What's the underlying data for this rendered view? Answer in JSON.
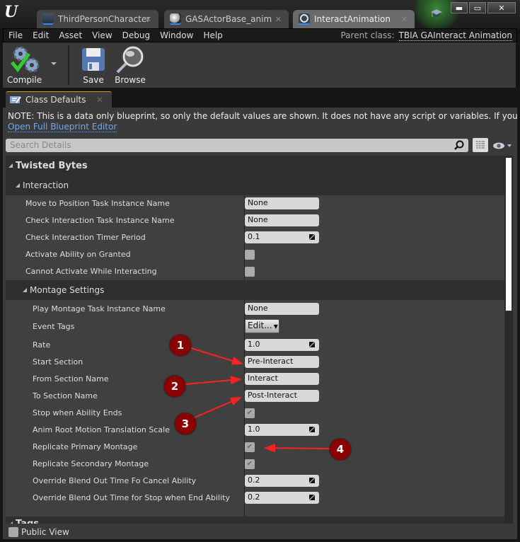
{
  "window": {
    "tabs": [
      {
        "label": "ThirdPersonCharacter",
        "icon": "character-blueprint-icon",
        "active": false
      },
      {
        "label": "GASActorBase_anim",
        "icon": "sphere-icon",
        "active": false
      },
      {
        "label": "InteractAnimation",
        "icon": "blueprint-ring-icon",
        "active": true
      }
    ],
    "controls": {
      "minimize": "▬",
      "maximize": "▭",
      "close": "✕"
    }
  },
  "menubar": {
    "items": [
      "File",
      "Edit",
      "Asset",
      "View",
      "Debug",
      "Window",
      "Help"
    ],
    "parent_class_label": "Parent class:",
    "parent_class_value": "TBIA GAInteract Animation"
  },
  "toolbar": {
    "compile_label": "Compile",
    "save_label": "Save",
    "browse_label": "Browse"
  },
  "panel": {
    "tab_label": "Class Defaults",
    "note": "NOTE: This is a data only blueprint, so only the default values are shown.  It does not have any script or variables.  If you want to add so",
    "open_full_editor_link": "Open Full Blueprint Editor",
    "search_placeholder": "Search Details",
    "public_view_label": "Public View"
  },
  "details": {
    "category": "Twisted Bytes",
    "interaction": {
      "label": "Interaction",
      "props": [
        {
          "label": "Move to Position Task Instance Name",
          "type": "text",
          "value": "None"
        },
        {
          "label": "Check Interaction Task Instance Name",
          "type": "text",
          "value": "None"
        },
        {
          "label": "Check Interaction Timer Period",
          "type": "number",
          "value": "0.1"
        },
        {
          "label": "Activate Ability on Granted",
          "type": "checkbox",
          "checked": false
        },
        {
          "label": "Cannot Activate While Interacting",
          "type": "checkbox",
          "checked": false
        }
      ]
    },
    "montage": {
      "label": "Montage Settings",
      "props": [
        {
          "label": "Play Montage Task Instance Name",
          "type": "text",
          "value": "None"
        },
        {
          "label": "Event Tags",
          "type": "button",
          "value": "Edit..."
        },
        {
          "label": "Rate",
          "type": "number",
          "value": "1.0"
        },
        {
          "label": "Start Section",
          "type": "text",
          "value": "Pre-Interact"
        },
        {
          "label": "From Section Name",
          "type": "text",
          "value": "Interact"
        },
        {
          "label": "To Section Name",
          "type": "text",
          "value": "Post-Interact"
        },
        {
          "label": "Stop when Ability Ends",
          "type": "checkbox",
          "checked": true
        },
        {
          "label": "Anim Root Motion Translation Scale",
          "type": "number",
          "value": "1.0"
        },
        {
          "label": "Replicate Primary Montage",
          "type": "checkbox",
          "checked": true
        },
        {
          "label": "Replicate Secondary Montage",
          "type": "checkbox",
          "checked": true
        },
        {
          "label": "Override Blend Out Time Fo Cancel Ability",
          "type": "number",
          "value": "0.2"
        },
        {
          "label": "Override Blend Out Time for Stop when End Ability",
          "type": "number",
          "value": "0.2"
        }
      ]
    },
    "tags_label": "Tags"
  },
  "annotations": [
    {
      "number": "1",
      "target": "Start Section"
    },
    {
      "number": "2",
      "target": "From Section Name"
    },
    {
      "number": "3",
      "target": "To Section Name"
    },
    {
      "number": "4",
      "target": "Replicate Primary Montage"
    }
  ],
  "colors": {
    "annotation": "#8b0000",
    "arrow": "#ff2020",
    "link": "#6fa8e8"
  }
}
